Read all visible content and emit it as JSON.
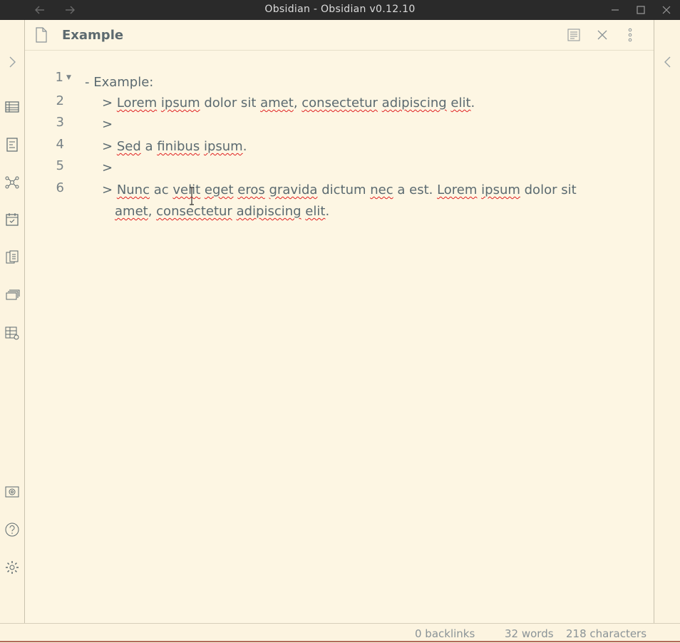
{
  "window": {
    "title": "Obsidian - Obsidian v0.12.10"
  },
  "nav": {
    "back_icon": "arrow-left-icon",
    "forward_icon": "arrow-right-icon"
  },
  "view": {
    "title": "Example"
  },
  "editor": {
    "lines": [
      {
        "num": "1",
        "segments": [
          {
            "t": "- Example:",
            "m": false
          }
        ]
      },
      {
        "num": "2",
        "segments": [
          {
            "t": "> ",
            "m": false
          },
          {
            "t": "Lorem",
            "m": true
          },
          {
            "t": " ",
            "m": false
          },
          {
            "t": "ipsum",
            "m": true
          },
          {
            "t": " dolor sit ",
            "m": false
          },
          {
            "t": "amet",
            "m": true
          },
          {
            "t": ", ",
            "m": false
          },
          {
            "t": "consectetur",
            "m": true
          },
          {
            "t": " ",
            "m": false
          },
          {
            "t": "adipiscing",
            "m": true
          },
          {
            "t": " ",
            "m": false
          },
          {
            "t": "elit",
            "m": true
          },
          {
            "t": ".",
            "m": false
          }
        ]
      },
      {
        "num": "3",
        "segments": [
          {
            "t": ">",
            "m": false
          }
        ]
      },
      {
        "num": "4",
        "segments": [
          {
            "t": "> ",
            "m": false
          },
          {
            "t": "Sed",
            "m": true
          },
          {
            "t": " a ",
            "m": false
          },
          {
            "t": "finibus",
            "m": true
          },
          {
            "t": " ",
            "m": false
          },
          {
            "t": "ipsum",
            "m": true
          },
          {
            "t": ".",
            "m": false
          }
        ]
      },
      {
        "num": "5",
        "segments": [
          {
            "t": ">",
            "m": false
          }
        ]
      },
      {
        "num": "6",
        "segments": [
          {
            "t": "> ",
            "m": false
          },
          {
            "t": "Nunc",
            "m": true
          },
          {
            "t": " ac ",
            "m": false
          },
          {
            "t": "velit",
            "m": true
          },
          {
            "t": " ",
            "m": false
          },
          {
            "t": "eget",
            "m": true
          },
          {
            "t": " ",
            "m": false
          },
          {
            "t": "eros",
            "m": true
          },
          {
            "t": " ",
            "m": false
          },
          {
            "t": "gravida",
            "m": true
          },
          {
            "t": " dictum ",
            "m": false
          },
          {
            "t": "nec",
            "m": true
          },
          {
            "t": " a est. ",
            "m": false
          },
          {
            "t": "Lorem",
            "m": true
          },
          {
            "t": " ",
            "m": false
          },
          {
            "t": "ipsum",
            "m": true
          },
          {
            "t": " dolor sit",
            "m": false
          }
        ]
      },
      {
        "num": "",
        "segments": [
          {
            "t": "amet",
            "m": true
          },
          {
            "t": ", ",
            "m": false
          },
          {
            "t": "consectetur",
            "m": true
          },
          {
            "t": " ",
            "m": false
          },
          {
            "t": "adipiscing",
            "m": true
          },
          {
            "t": " ",
            "m": false
          },
          {
            "t": "elit",
            "m": true
          },
          {
            "t": ".",
            "m": false
          }
        ]
      }
    ]
  },
  "status": {
    "backlinks": "0 backlinks",
    "words": "32 words",
    "characters": "218 characters"
  },
  "colors": {
    "background": "#fdf6e3",
    "titlebar": "#2a2a2a",
    "text": "#5b6a70",
    "misspell": "#e02020"
  }
}
